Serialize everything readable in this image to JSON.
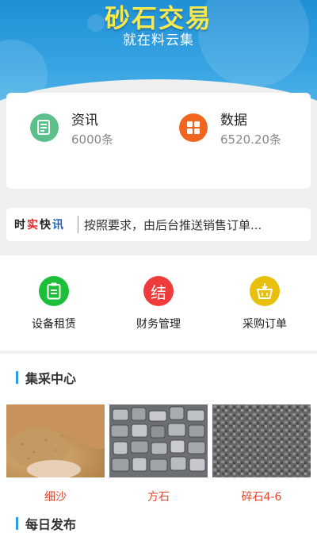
{
  "header": {
    "title": "砂石交易",
    "subtitle": "就在料云集"
  },
  "stats": [
    {
      "label": "资讯",
      "value": "6000条",
      "icon": "newspaper-icon",
      "color": "#5dbf8a"
    },
    {
      "label": "数据",
      "value": "6520.20条",
      "icon": "grid-icon",
      "color": "#f0651f"
    }
  ],
  "news": {
    "tag_chars": [
      {
        "char": "时",
        "color": "#222222"
      },
      {
        "char": "实",
        "color": "#e02b2b"
      },
      {
        "char": "快",
        "color": "#222222"
      },
      {
        "char": "讯",
        "color": "#1f63c9"
      }
    ],
    "text": "按照要求，由后台推送销售订单..."
  },
  "menu": [
    {
      "label": "设备租赁",
      "icon": "clipboard-icon",
      "color": "#1dbf3a"
    },
    {
      "label": "财务管理",
      "icon": "settle-icon",
      "glyph": "结",
      "color": "#ef3b3b"
    },
    {
      "label": "采购订单",
      "icon": "basket-icon",
      "color": "#e8c00c"
    }
  ],
  "sections": {
    "purchase_center": "集采中心",
    "daily_release": "每日发布"
  },
  "products": [
    {
      "name": "细沙"
    },
    {
      "name": "方石"
    },
    {
      "name": "碎石4-6"
    }
  ],
  "colors": {
    "accent": "#2b9fe0",
    "product_name": "#e4452b",
    "title_yellow": "#f6e94f"
  }
}
